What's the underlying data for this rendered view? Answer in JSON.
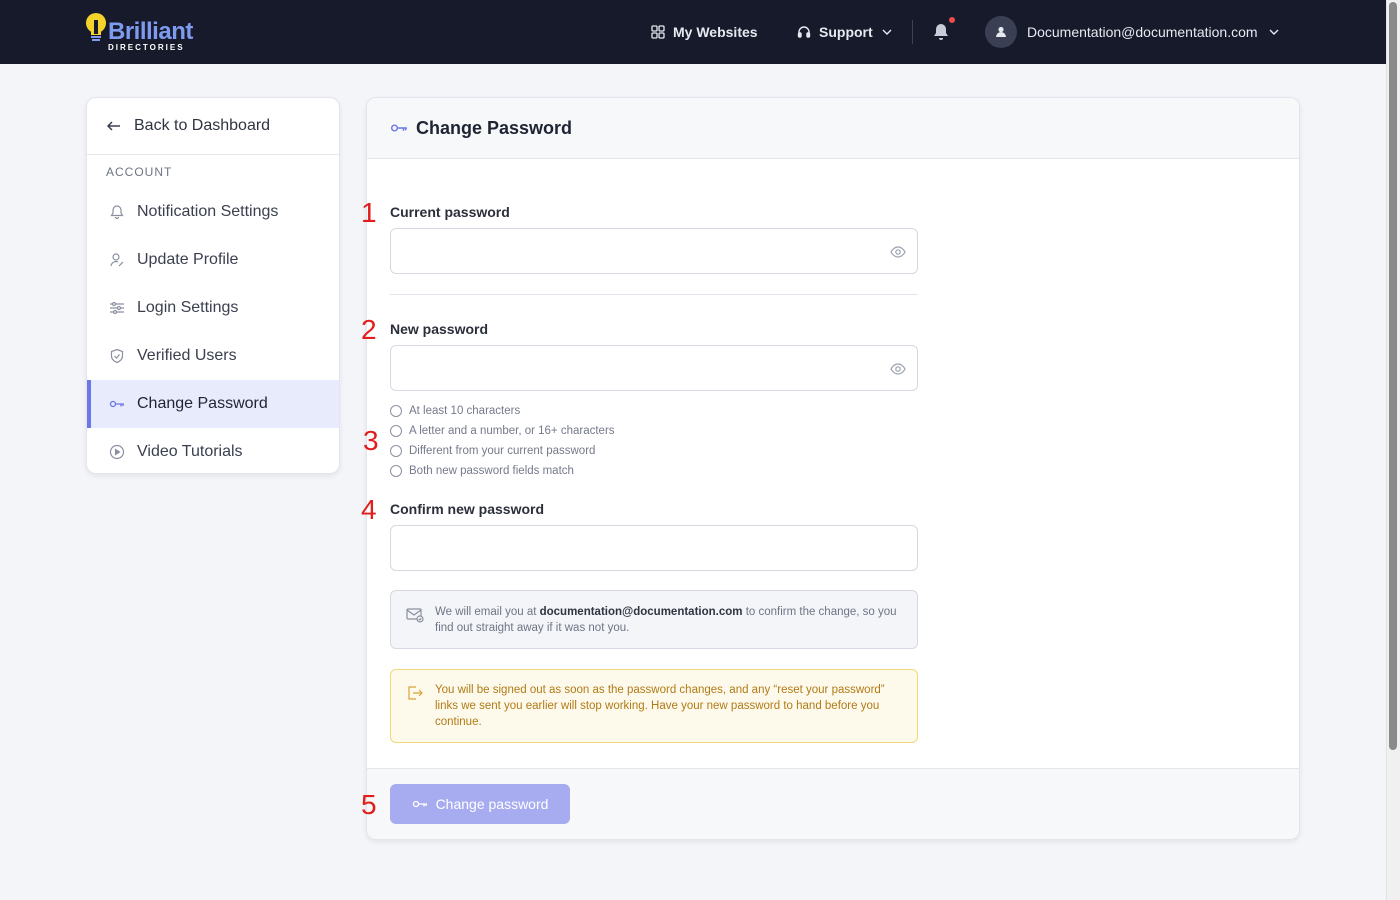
{
  "header": {
    "logo_brand": "Brilliant",
    "logo_sub": "DIRECTORIES",
    "nav": {
      "my_websites": "My Websites",
      "support": "Support"
    },
    "user_email": "Documentation@documentation.com"
  },
  "sidebar": {
    "back_label": "Back to Dashboard",
    "section_label": "ACCOUNT",
    "items": [
      {
        "label": "Notification Settings",
        "icon": "bell-icon"
      },
      {
        "label": "Update Profile",
        "icon": "user-edit-icon"
      },
      {
        "label": "Login Settings",
        "icon": "sliders-icon"
      },
      {
        "label": "Verified Users",
        "icon": "shield-check-icon"
      },
      {
        "label": "Change Password",
        "icon": "key-icon",
        "active": true
      },
      {
        "label": "Video Tutorials",
        "icon": "play-circle-icon"
      }
    ]
  },
  "main": {
    "title": "Change Password",
    "step_numbers": [
      "1",
      "2",
      "3",
      "4",
      "5"
    ],
    "current_password_label": "Current password",
    "new_password_label": "New password",
    "requirements": [
      "At least 10 characters",
      "A letter and a number, or 16+ characters",
      "Different from your current password",
      "Both new password fields match"
    ],
    "confirm_password_label": "Confirm new password",
    "info_prefix": "We will email you at ",
    "info_email": "documentation@documentation.com",
    "info_suffix": " to confirm the change, so you find out straight away if it was not you.",
    "warning_text": "You will be signed out as soon as the password changes, and any “reset your password” links we sent you earlier will stop working. Have your new password to hand before you continue.",
    "submit_label": "Change password"
  },
  "colors": {
    "topbar": "#161a2b",
    "accent": "#6c78e8",
    "button_disabled": "#a7acf0",
    "step_number": "#e11d1d"
  }
}
